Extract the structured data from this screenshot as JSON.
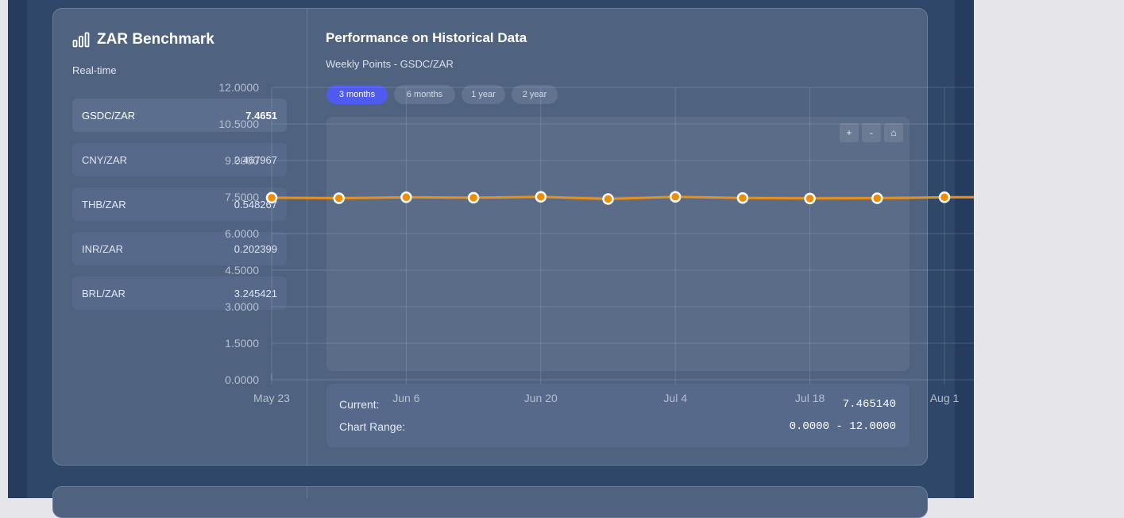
{
  "benchmark": {
    "title": "ZAR Benchmark",
    "subtitle": "Real-time",
    "rates": [
      {
        "pair": "GSDC/ZAR",
        "value": "7.4651"
      },
      {
        "pair": "CNY/ZAR",
        "value": "2.467967"
      },
      {
        "pair": "THB/ZAR",
        "value": "0.548267"
      },
      {
        "pair": "INR/ZAR",
        "value": "0.202399"
      },
      {
        "pair": "BRL/ZAR",
        "value": "3.245421"
      }
    ]
  },
  "performance": {
    "title": "Performance on Historical Data",
    "subtitle": "Weekly Points - GSDC/ZAR",
    "ranges": [
      "3 months",
      "6 months",
      "1 year",
      "2 year"
    ],
    "active_range": "3 months",
    "zoom": {
      "in": "+",
      "out": "-",
      "home": "⌂"
    },
    "current_label": "Current:",
    "current_value": "7.465140",
    "range_label": "Chart Range:",
    "range_value": "0.0000 - 12.0000"
  },
  "colors": {
    "accent": "#4f5bf0",
    "line": "#e8901c",
    "point": "#f08c00"
  },
  "chart_data": {
    "type": "line",
    "ylim": [
      0,
      12
    ],
    "y_ticks": [
      "0.0000",
      "1.5000",
      "3.0000",
      "4.5000",
      "6.0000",
      "7.5000",
      "9.0000",
      "10.5000",
      "12.0000"
    ],
    "x_tick_labels": [
      "May 23",
      "Jun 6",
      "Jun 20",
      "Jul 4",
      "Jul 18",
      "Aug 1"
    ],
    "x": [
      "May 23",
      "May 30",
      "Jun 6",
      "Jun 13",
      "Jun 20",
      "Jun 27",
      "Jul 4",
      "Jul 11",
      "Jul 18",
      "Jul 25",
      "Aug 1"
    ],
    "series": [
      {
        "values": [
          7.47,
          7.45,
          7.49,
          7.47,
          7.51,
          7.42,
          7.51,
          7.46,
          7.44,
          7.45,
          7.49
        ]
      }
    ],
    "grid": true
  }
}
